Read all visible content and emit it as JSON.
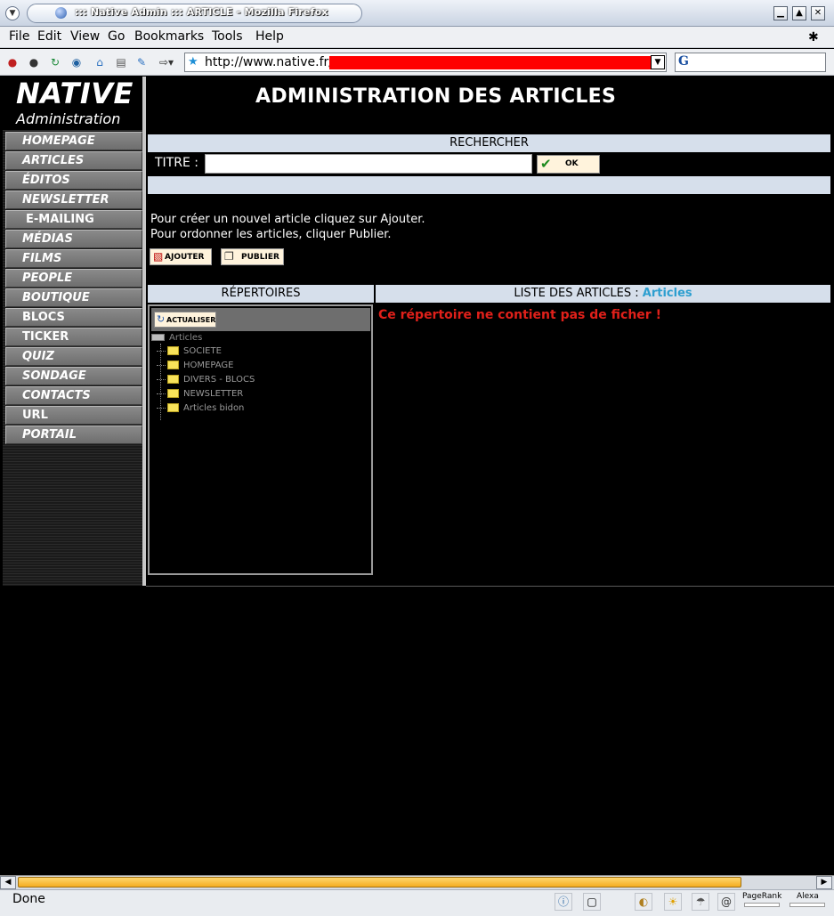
{
  "window": {
    "title": "::: Native Admin ::: ARTICLE - Mozilla Firefox"
  },
  "menu": {
    "file": "File",
    "edit": "Edit",
    "view": "View",
    "go": "Go",
    "bookmarks": "Bookmarks",
    "tools": "Tools",
    "help": "Help"
  },
  "toolbar": {
    "url": "http://www.native.fr/"
  },
  "logo": {
    "line1": "NATIVE",
    "line2": "Administration"
  },
  "sidebar": {
    "items": [
      {
        "label": "HOMEPAGE"
      },
      {
        "label": "ARTICLES"
      },
      {
        "label": "ÉDITOS"
      },
      {
        "label": "NEWSLETTER"
      },
      {
        "label": "E-MAILING"
      },
      {
        "label": "MÉDIAS"
      },
      {
        "label": "FILMS"
      },
      {
        "label": "PEOPLE"
      },
      {
        "label": "BOUTIQUE"
      },
      {
        "label": "BLOCS"
      },
      {
        "label": "TICKER"
      },
      {
        "label": "QUIZ"
      },
      {
        "label": "SONDAGE"
      },
      {
        "label": "CONTACTS"
      },
      {
        "label": "URL"
      },
      {
        "label": "PORTAIL"
      }
    ]
  },
  "main": {
    "title": "ADMINISTRATION DES ARTICLES"
  },
  "search": {
    "header": "RECHERCHER",
    "titre_label": "TITRE :",
    "titre_value": "",
    "ok_label": "OK"
  },
  "instructions": {
    "line1": "Pour créer un nouvel article cliquez sur Ajouter.",
    "line2": "Pour ordonner les articles, cliquer Publier.",
    "add_label": "AJOUTER",
    "publish_label": "PUBLIER"
  },
  "repertoires": {
    "header": "RÉPERTOIRES",
    "refresh_label": "ACTUALISER",
    "root": "Articles",
    "folders": [
      "SOCIETE",
      "HOMEPAGE",
      "DIVERS - BLOCS",
      "NEWSLETTER",
      "Articles bidon"
    ]
  },
  "list": {
    "header": "LISTE DES ARTICLES :",
    "current": "Articles",
    "empty_message": "Ce répertoire ne contient pas de ficher !"
  },
  "status": {
    "text": "Done",
    "pagerank": "PageRank",
    "alexa": "Alexa"
  }
}
